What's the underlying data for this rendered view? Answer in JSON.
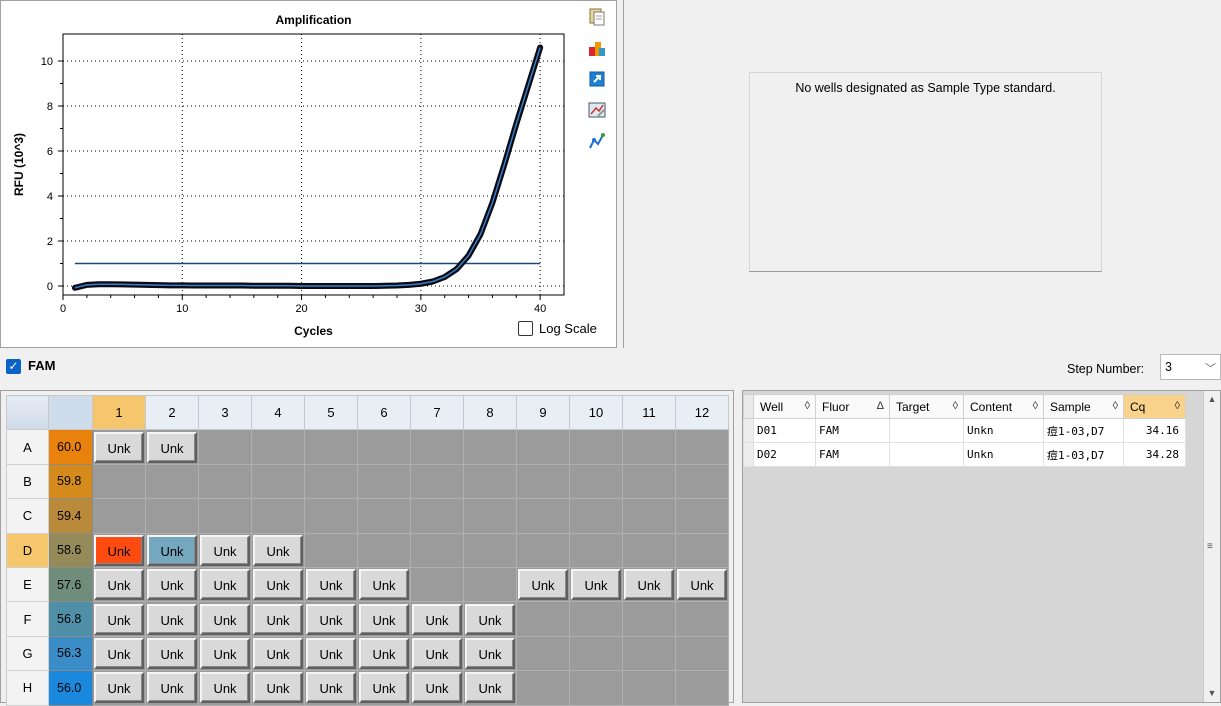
{
  "chart_panel": {
    "log_scale_label": "Log Scale",
    "log_scale_checked": false,
    "tool_icons": [
      "copy-icon",
      "plate-icon",
      "export-icon",
      "chart-settings-icon",
      "curve-icon"
    ]
  },
  "chart_data": {
    "type": "line",
    "title": "Amplification",
    "xlabel": "Cycles",
    "ylabel": "RFU (10^3)",
    "xlim": [
      0,
      42
    ],
    "ylim": [
      -0.4,
      11.2
    ],
    "xticks": [
      "0",
      "10",
      "20",
      "30",
      "40"
    ],
    "yticks": [
      "0",
      "2",
      "4",
      "6",
      "8",
      "10"
    ],
    "grid": true,
    "threshold": 1.0,
    "series": [
      {
        "x": [
          1,
          2,
          3,
          4,
          5,
          6,
          7,
          8,
          9,
          10,
          11,
          12,
          13,
          14,
          15,
          16,
          17,
          18,
          19,
          20,
          21,
          22,
          23,
          24,
          25,
          26,
          27,
          28,
          29,
          30,
          31,
          32,
          33,
          34,
          35,
          36,
          37,
          38,
          39,
          40
        ],
        "y": [
          -0.08,
          0.05,
          0.08,
          0.08,
          0.07,
          0.06,
          0.05,
          0.04,
          0.03,
          0.03,
          0.02,
          0.02,
          0.02,
          0.02,
          0.02,
          0.01,
          0.01,
          0.01,
          0.01,
          0.0,
          0.0,
          0.0,
          0.0,
          0.0,
          0.0,
          0.0,
          0.01,
          0.02,
          0.05,
          0.1,
          0.2,
          0.4,
          0.75,
          1.35,
          2.3,
          3.7,
          5.4,
          7.2,
          8.9,
          10.6
        ]
      }
    ]
  },
  "standard_curve": {
    "message": "No wells designated as Sample Type standard."
  },
  "fluor": {
    "label": "FAM",
    "checked": true
  },
  "step": {
    "label": "Step Number:",
    "value": "3"
  },
  "plate": {
    "columns": [
      "1",
      "2",
      "3",
      "4",
      "5",
      "6",
      "7",
      "8",
      "9",
      "10",
      "11",
      "12"
    ],
    "selected_row": "D",
    "selected_col": "1",
    "rows": [
      {
        "label": "A",
        "temp": "60.0",
        "temp_color": "#e8820c",
        "wells": [
          "Unk",
          "Unk",
          "",
          "",
          "",
          "",
          "",
          "",
          "",
          "",
          "",
          ""
        ]
      },
      {
        "label": "B",
        "temp": "59.8",
        "temp_color": "#d58a1c",
        "wells": [
          "",
          "",
          "",
          "",
          "",
          "",
          "",
          "",
          "",
          "",
          "",
          ""
        ]
      },
      {
        "label": "C",
        "temp": "59.4",
        "temp_color": "#b88a3a",
        "wells": [
          "",
          "",
          "",
          "",
          "",
          "",
          "",
          "",
          "",
          "",
          "",
          ""
        ]
      },
      {
        "label": "D",
        "temp": "58.6",
        "temp_color": "#958a5a",
        "wells": [
          "Unk",
          "Unk",
          "Unk",
          "Unk",
          "",
          "",
          "",
          "",
          "",
          "",
          "",
          ""
        ]
      },
      {
        "label": "E",
        "temp": "57.6",
        "temp_color": "#6f8d7a",
        "wells": [
          "Unk",
          "Unk",
          "Unk",
          "Unk",
          "Unk",
          "Unk",
          "",
          "",
          "Unk",
          "Unk",
          "Unk",
          "Unk"
        ]
      },
      {
        "label": "F",
        "temp": "56.8",
        "temp_color": "#4f8fa8",
        "wells": [
          "Unk",
          "Unk",
          "Unk",
          "Unk",
          "Unk",
          "Unk",
          "Unk",
          "Unk",
          "",
          "",
          "",
          ""
        ]
      },
      {
        "label": "G",
        "temp": "56.3",
        "temp_color": "#3a8dc6",
        "wells": [
          "Unk",
          "Unk",
          "Unk",
          "Unk",
          "Unk",
          "Unk",
          "Unk",
          "Unk",
          "",
          "",
          "",
          ""
        ]
      },
      {
        "label": "H",
        "temp": "56.0",
        "temp_color": "#1a88dc",
        "wells": [
          "Unk",
          "Unk",
          "Unk",
          "Unk",
          "Unk",
          "Unk",
          "Unk",
          "Unk",
          "",
          "",
          "",
          ""
        ]
      }
    ],
    "highlight": {
      "D1": "hot",
      "D2": "teal"
    }
  },
  "results": {
    "columns": [
      {
        "label": "Well",
        "sort": "◊"
      },
      {
        "label": "Fluor",
        "sort": "Δ"
      },
      {
        "label": "Target",
        "sort": "◊"
      },
      {
        "label": "Content",
        "sort": "◊"
      },
      {
        "label": "Sample",
        "sort": "◊"
      },
      {
        "label": "Cq",
        "sort": "◊"
      }
    ],
    "rows": [
      [
        "D01",
        "FAM",
        "",
        "Unkn",
        "痘1-03,D7",
        "34.16"
      ],
      [
        "D02",
        "FAM",
        "",
        "Unkn",
        "痘1-03,D7",
        "34.28"
      ]
    ]
  }
}
